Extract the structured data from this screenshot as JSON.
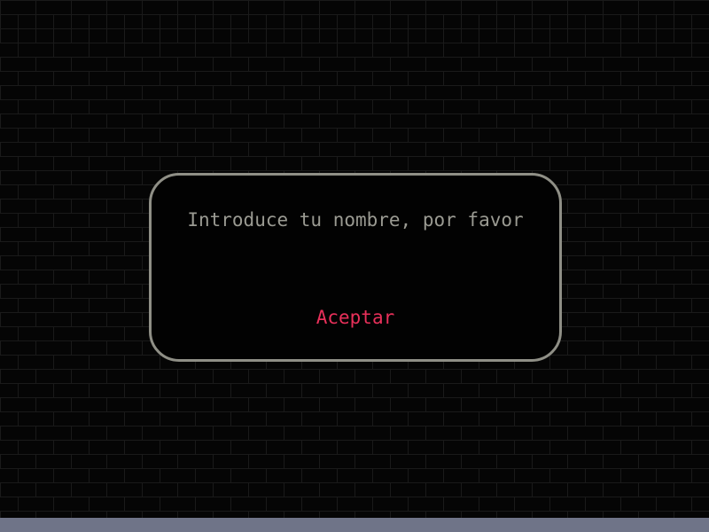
{
  "dialog": {
    "prompt": "Introduce tu nombre, por favor",
    "name_value": "",
    "accept_label": "Aceptar"
  },
  "colors": {
    "background": "#050505",
    "brick_lines": "#1a1a1a",
    "dialog_border": "#8f8f86",
    "prompt_text": "#9a9a92",
    "accept_text": "#e8305a",
    "bottom_bar": "#6f7488"
  }
}
